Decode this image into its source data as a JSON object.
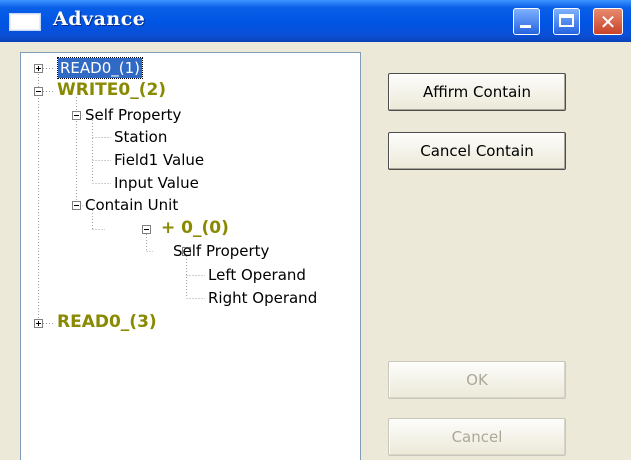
{
  "window": {
    "title": "Advance"
  },
  "tree": {
    "nodes": [
      {
        "id": "read0-1",
        "label": "READ0_(1)"
      },
      {
        "id": "write0-2",
        "label": "WRITE0_(2)"
      },
      {
        "id": "self-property-1",
        "label": "Self Property"
      },
      {
        "id": "station",
        "label": "Station"
      },
      {
        "id": "field1-value",
        "label": "Field1 Value"
      },
      {
        "id": "input-value",
        "label": "Input Value"
      },
      {
        "id": "contain-unit",
        "label": "Contain Unit"
      },
      {
        "id": "plus-0-0",
        "label": "+ 0_(0)"
      },
      {
        "id": "self-property-2",
        "label": "Self Property"
      },
      {
        "id": "left-operand",
        "label": "Left Operand"
      },
      {
        "id": "right-operand",
        "label": "Right Operand"
      },
      {
        "id": "read0-3",
        "label": "READ0_(3)"
      }
    ]
  },
  "buttons": {
    "affirm": "Affirm Contain",
    "cancel_contain": "Cancel Contain",
    "ok": "OK",
    "cancel": "Cancel"
  },
  "colors": {
    "titlebar": "#0054e3",
    "selection": "#316ac5",
    "emphasis_text": "#8a8a00"
  }
}
